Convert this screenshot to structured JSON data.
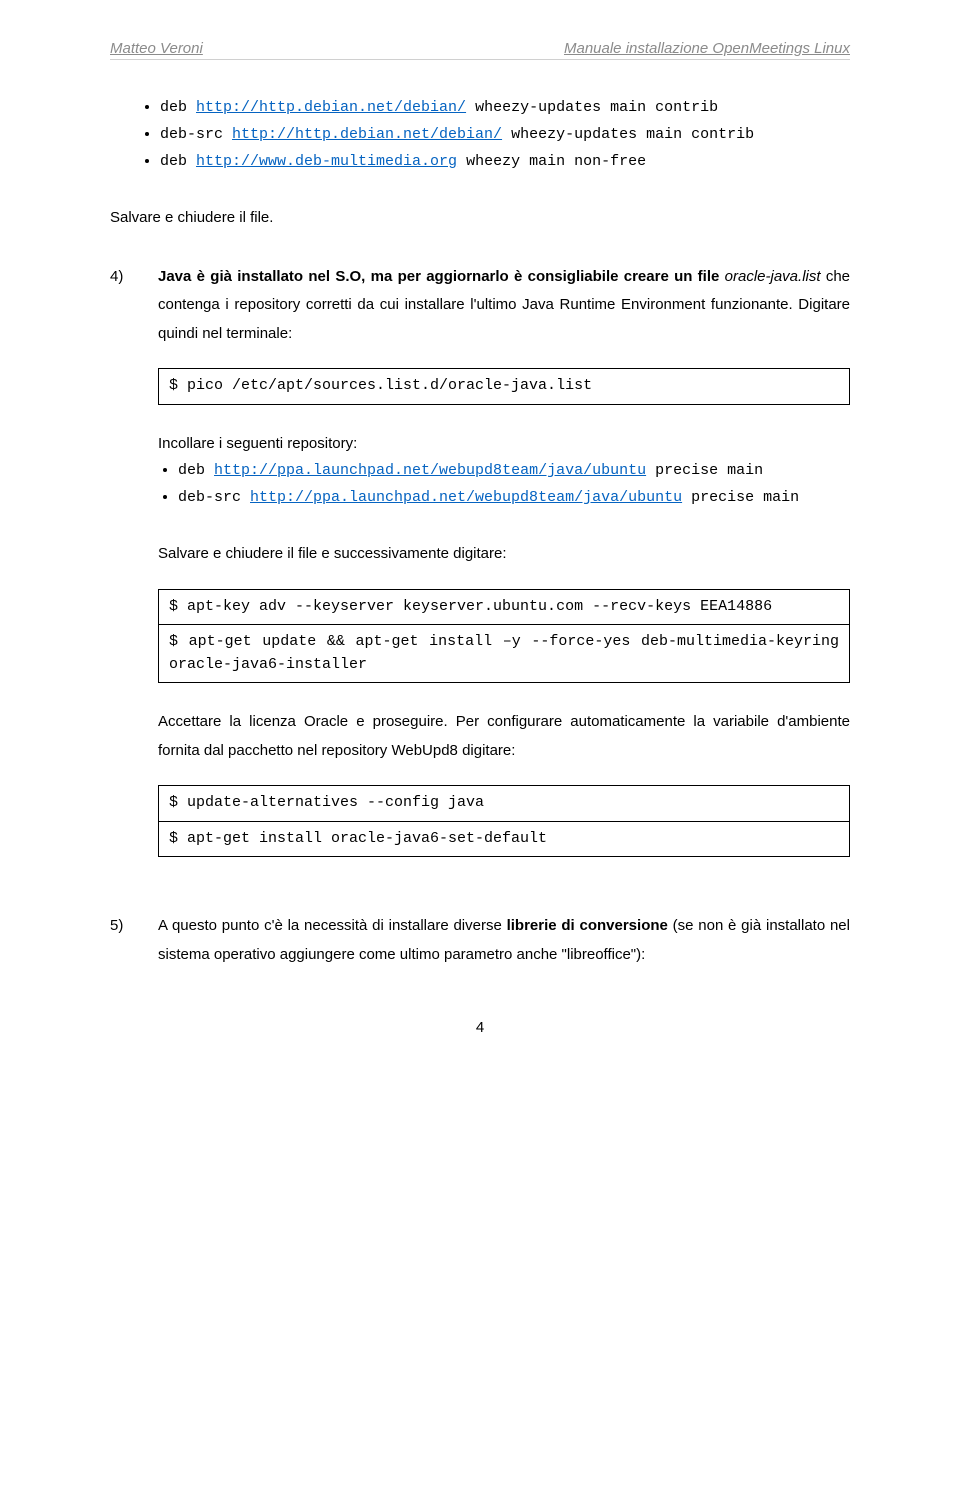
{
  "header": {
    "left": "Matteo Veroni",
    "right": "Manuale installazione OpenMeetings Linux"
  },
  "top_bullets": {
    "b1_prefix": "deb ",
    "b1_link": "http://http.debian.net/debian/",
    "b1_suffix": " wheezy-updates main contrib",
    "b2_prefix": "deb-src ",
    "b2_link": "http://http.debian.net/debian/",
    "b2_suffix": " wheezy-updates main contrib",
    "b3_prefix": "deb ",
    "b3_link": "http://www.deb-multimedia.org",
    "b3_suffix": " wheezy main non-free"
  },
  "save_close": "Salvare e chiudere il file.",
  "step4": {
    "num": "4)",
    "text_a": "Java è già installato nel S.O, ma per aggiornarlo è consigliabile creare un file ",
    "file": "oracle-java.list",
    "text_b": " che contenga i repository corretti da cui installare l'ultimo Java Runtime Environment funzionante. Digitare quindi nel terminale:",
    "cmd1": "$ pico /etc/apt/sources.list.d/oracle-java.list",
    "paste_repo": "Incollare i seguenti repository:",
    "r1_prefix": "deb ",
    "r1_link": "http://ppa.launchpad.net/webupd8team/java/ubuntu",
    "r1_suffix": " precise main",
    "r2_prefix": "deb-src ",
    "r2_link": "http://ppa.launchpad.net/webupd8team/java/ubuntu",
    "r2_suffix": " precise main",
    "save_close2": "Salvare e chiudere il file e successivamente digitare:",
    "cmd2a": "$ apt-key adv --keyserver keyserver.ubuntu.com --recv-keys EEA14886",
    "cmd2b": "$ apt-get update && apt-get install –y --force-yes deb-multimedia-keyring oracle-java6-installer",
    "accept": "Accettare la licenza Oracle e proseguire. Per configurare automaticamente la variabile d'ambiente fornita dal pacchetto nel repository WebUpd8 digitare:",
    "cmd3a": "$ update-alternatives --config java",
    "cmd3b": "$ apt-get install oracle-java6-set-default"
  },
  "step5": {
    "num": "5)",
    "text_a": "A questo punto c'è la necessità di installare diverse ",
    "bold": "librerie di conversione",
    "text_b": " (se non è già installato nel sistema operativo aggiungere come ultimo parametro anche \"libreoffice\"):"
  },
  "pagenum": "4"
}
